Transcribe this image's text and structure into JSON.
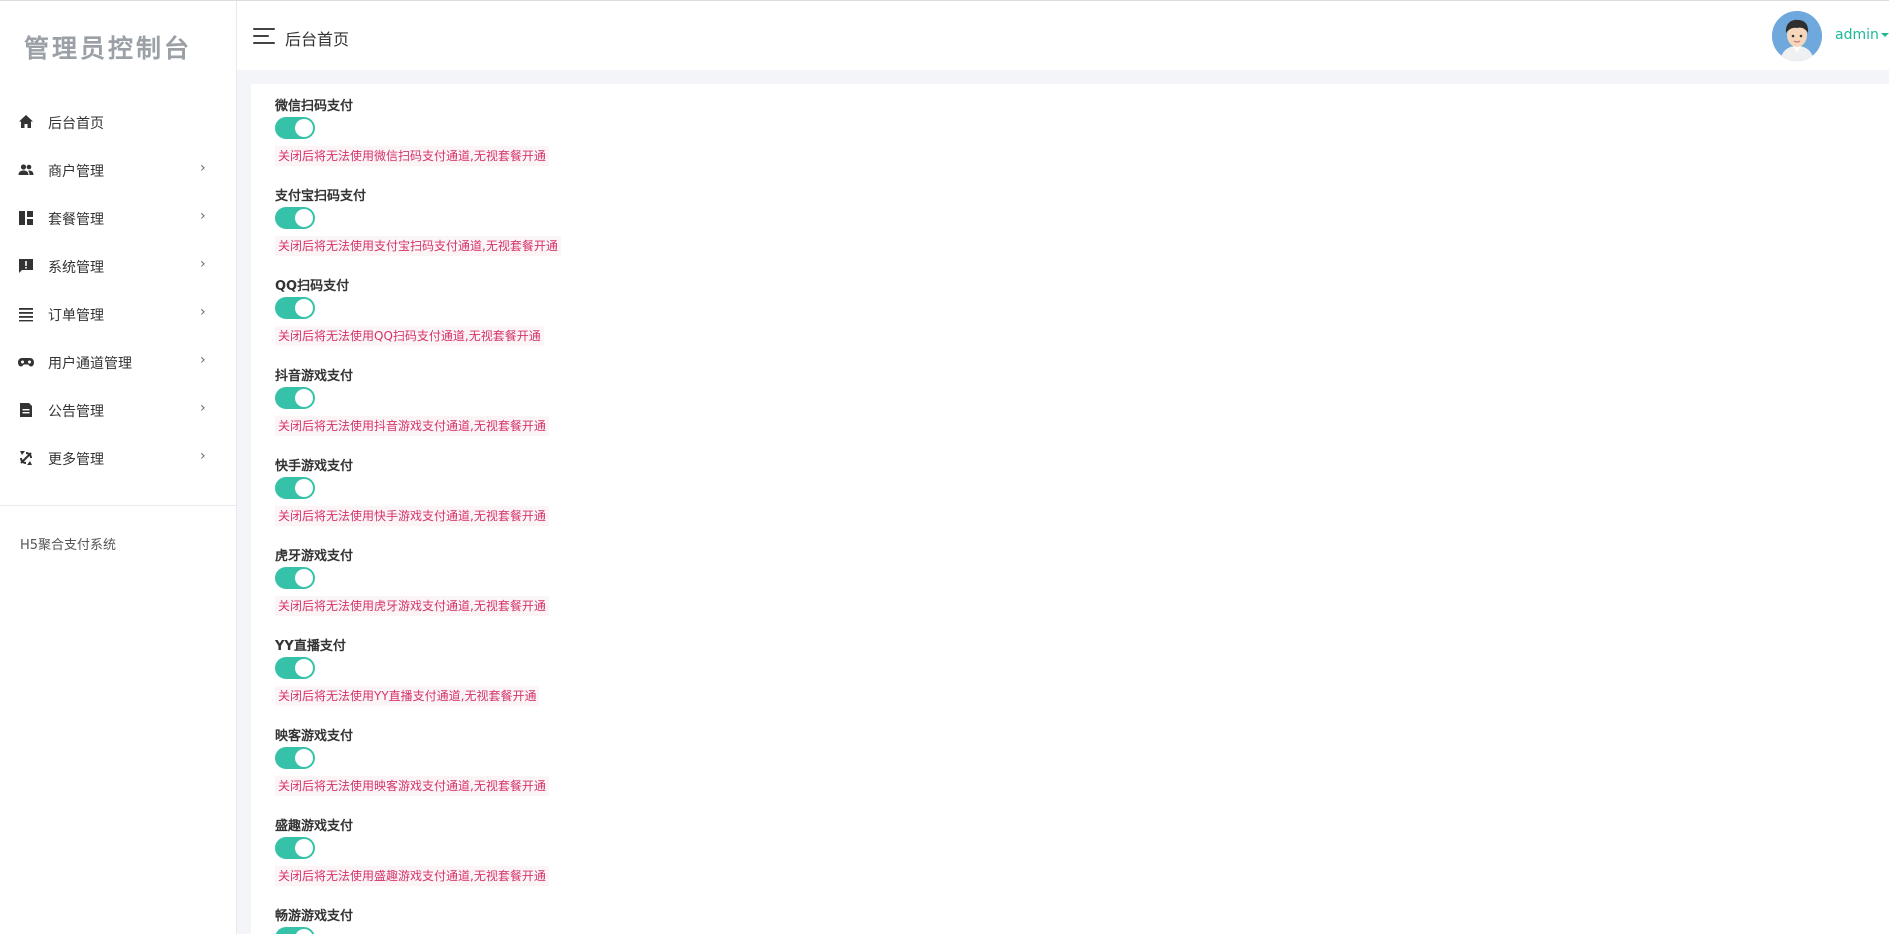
{
  "sidebar": {
    "logo": "管理员控制台",
    "items": [
      {
        "label": "后台首页",
        "icon": "home-icon",
        "has_chevron": false
      },
      {
        "label": "商户管理",
        "icon": "users-icon",
        "has_chevron": true
      },
      {
        "label": "套餐管理",
        "icon": "dashboard-icon",
        "has_chevron": true
      },
      {
        "label": "系统管理",
        "icon": "report-icon",
        "has_chevron": true
      },
      {
        "label": "订单管理",
        "icon": "list-icon",
        "has_chevron": true
      },
      {
        "label": "用户通道管理",
        "icon": "gamepad-icon",
        "has_chevron": true
      },
      {
        "label": "公告管理",
        "icon": "document-icon",
        "has_chevron": true
      },
      {
        "label": "更多管理",
        "icon": "refresh-icon",
        "has_chevron": true
      }
    ],
    "chevron": "›",
    "footer": "H5聚合支付系统"
  },
  "header": {
    "title": "后台首页",
    "user": "admin"
  },
  "settings": [
    {
      "label": "微信扫码支付",
      "enabled": true,
      "hint": "关闭后将无法使用微信扫码支付通道,无视套餐开通"
    },
    {
      "label": "支付宝扫码支付",
      "enabled": true,
      "hint": "关闭后将无法使用支付宝扫码支付通道,无视套餐开通"
    },
    {
      "label": "QQ扫码支付",
      "enabled": true,
      "hint": "关闭后将无法使用QQ扫码支付通道,无视套餐开通"
    },
    {
      "label": "抖音游戏支付",
      "enabled": true,
      "hint": "关闭后将无法使用抖音游戏支付通道,无视套餐开通"
    },
    {
      "label": "快手游戏支付",
      "enabled": true,
      "hint": "关闭后将无法使用快手游戏支付通道,无视套餐开通"
    },
    {
      "label": "虎牙游戏支付",
      "enabled": true,
      "hint": "关闭后将无法使用虎牙游戏支付通道,无视套餐开通"
    },
    {
      "label": "YY直播支付",
      "enabled": true,
      "hint": "关闭后将无法使用YY直播支付通道,无视套餐开通"
    },
    {
      "label": "映客游戏支付",
      "enabled": true,
      "hint": "关闭后将无法使用映客游戏支付通道,无视套餐开通"
    },
    {
      "label": "盛趣游戏支付",
      "enabled": true,
      "hint": "关闭后将无法使用盛趣游戏支付通道,无视套餐开通"
    },
    {
      "label": "畅游游戏支付",
      "enabled": true,
      "hint": ""
    }
  ],
  "colors": {
    "accent": "#35c2a8",
    "username": "#1bb99a",
    "hint_text": "#d6336c",
    "hint_bg": "#fbf5f6",
    "logo": "#9aa0a6"
  }
}
